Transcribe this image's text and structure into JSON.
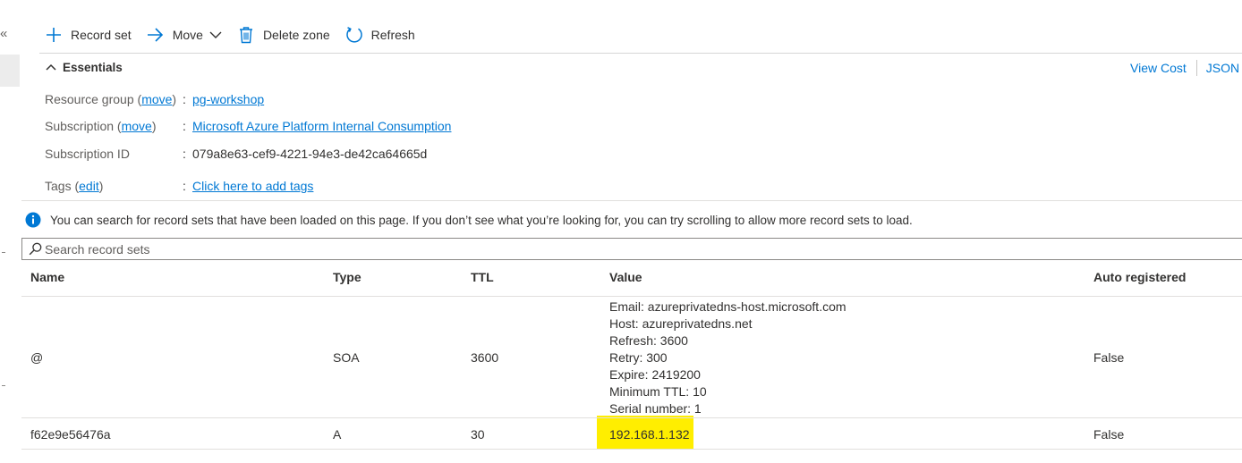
{
  "nav": {
    "collapse_glyph": "«"
  },
  "toolbar": {
    "record_set": "Record set",
    "move": "Move",
    "delete_zone": "Delete zone",
    "refresh": "Refresh"
  },
  "essentials": {
    "title": "Essentials",
    "view_cost": "View Cost",
    "json_view": "JSON V",
    "resource_group": {
      "label": "Resource group",
      "action": "move",
      "value": "pg-workshop"
    },
    "subscription": {
      "label": "Subscription",
      "action": "move",
      "value": "Microsoft Azure Platform Internal Consumption"
    },
    "subscription_id": {
      "label": "Subscription ID",
      "value": "079a8e63-cef9-4221-94e3-de42ca64665d"
    },
    "tags": {
      "label": "Tags",
      "action": "edit",
      "value": "Click here to add tags"
    }
  },
  "info_message": "You can search for record sets that have been loaded on this page. If you don’t see what you’re looking for, you can try scrolling to allow more record sets to load.",
  "search": {
    "placeholder": "Search record sets"
  },
  "table": {
    "headers": {
      "name": "Name",
      "type": "Type",
      "ttl": "TTL",
      "value": "Value",
      "auto": "Auto registered"
    },
    "rows": [
      {
        "name": "@",
        "type": "SOA",
        "ttl": "3600",
        "value_lines": [
          "Email: azureprivatedns-host.microsoft.com",
          "Host: azureprivatedns.net",
          "Refresh: 3600",
          "Retry: 300",
          "Expire: 2419200",
          "Minimum TTL: 10",
          "Serial number: 1"
        ],
        "auto": "False"
      },
      {
        "name": "f62e9e56476a",
        "type": "A",
        "ttl": "30",
        "value": "192.168.1.132",
        "auto": "False"
      }
    ]
  },
  "colors": {
    "accent": "#0078d4",
    "highlight": "#ffee00",
    "text": "#323130"
  }
}
